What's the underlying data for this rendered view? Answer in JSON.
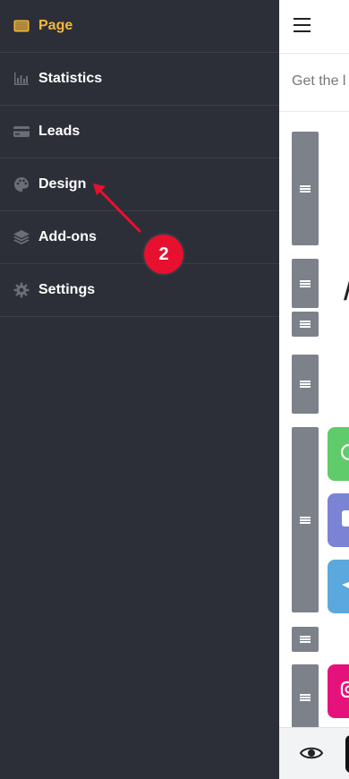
{
  "sidebar": {
    "items": [
      {
        "label": "Page",
        "icon": "browser-window-icon",
        "active": true
      },
      {
        "label": "Statistics",
        "icon": "bar-chart-icon",
        "active": false
      },
      {
        "label": "Leads",
        "icon": "credit-card-icon",
        "active": false
      },
      {
        "label": "Design",
        "icon": "palette-icon",
        "active": false
      },
      {
        "label": "Add-ons",
        "icon": "layers-icon",
        "active": false
      },
      {
        "label": "Settings",
        "icon": "gear-icon",
        "active": false
      }
    ]
  },
  "preview": {
    "subtitle": "Get the l",
    "menu_icon": "hamburger-icon",
    "preview_icon": "eye-icon"
  },
  "annotation": {
    "number": "2",
    "color": "#e8102f"
  },
  "colors": {
    "sidebar_bg": "#2d2f38",
    "active": "#f4b83b",
    "handle": "#7c818a",
    "whatsapp": "#5fcb6a",
    "discord": "#7b83d4",
    "telegram": "#5aa8dd",
    "instagram": "#e6127c"
  }
}
